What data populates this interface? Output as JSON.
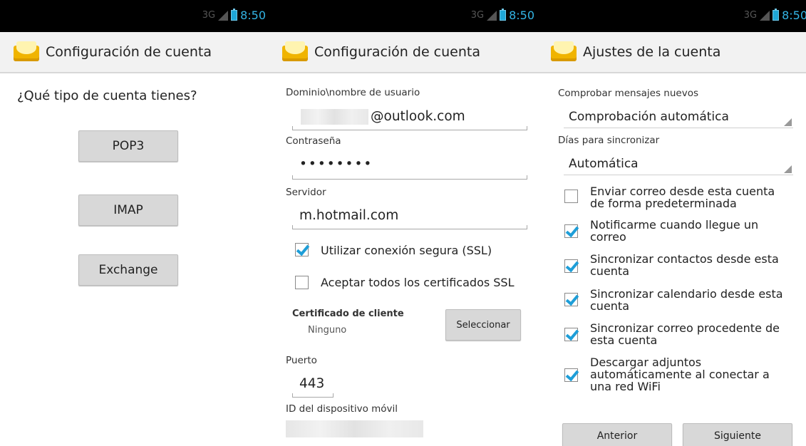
{
  "status": {
    "time": "8:50",
    "network": "3G"
  },
  "screens": [
    {
      "title": "Configuración de cuenta",
      "question": "¿Qué tipo de cuenta tienes?",
      "options": [
        "POP3",
        "IMAP",
        "Exchange"
      ]
    },
    {
      "title": "Configuración de cuenta",
      "domain_label": "Dominio\\nombre de usuario",
      "username_value": "@outlook.com",
      "password_label": "Contraseña",
      "password_value": "••••••••",
      "server_label": "Servidor",
      "server_value": "m.hotmail.com",
      "ssl_label": "Utilizar conexión segura (SSL)",
      "ssl_checked": true,
      "certs_label": "Aceptar todos los certificados SSL",
      "certs_checked": false,
      "client_cert_label": "Certificado de cliente",
      "client_cert_value": "Ninguno",
      "select_button": "Seleccionar",
      "port_label": "Puerto",
      "port_value": "443",
      "device_id_label": "ID del dispositivo móvil"
    },
    {
      "title": "Ajustes de la cuenta",
      "check_label": "Comprobar mensajes nuevos",
      "check_value": "Comprobación automática",
      "sync_days_label": "Días para sincronizar",
      "sync_days_value": "Automática",
      "options": [
        {
          "line1": "Enviar correo desde esta cuenta",
          "line2": "de forma predeterminada",
          "line3": "",
          "checked": false
        },
        {
          "line1": "Notificarme cuando llegue un",
          "line2": "correo",
          "line3": "",
          "checked": true
        },
        {
          "line1": "Sincronizar contactos desde esta",
          "line2": "cuenta",
          "line3": "",
          "checked": true
        },
        {
          "line1": "Sincronizar calendario desde esta",
          "line2": "cuenta",
          "line3": "",
          "checked": true
        },
        {
          "line1": "Sincronizar correo procedente de",
          "line2": "esta cuenta",
          "line3": "",
          "checked": true
        },
        {
          "line1": "Descargar adjuntos",
          "line2": "automáticamente al conectar a",
          "line3": "una red WiFi",
          "checked": true
        }
      ],
      "back_button": "Anterior",
      "next_button": "Siguiente"
    }
  ]
}
